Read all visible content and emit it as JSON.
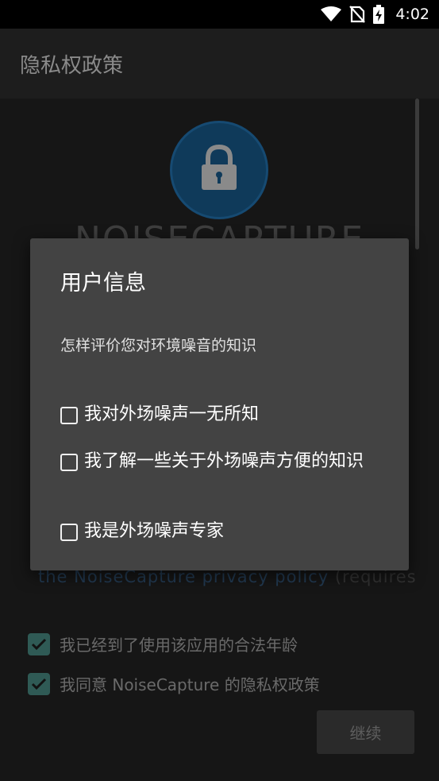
{
  "status_bar": {
    "time": "4:02",
    "icons": [
      "wifi-icon",
      "no-sim-icon",
      "battery-charging-icon"
    ]
  },
  "app_bar": {
    "title": "隐私权政策"
  },
  "background": {
    "logo_icon": "lock-icon",
    "logo_text": "NOISECAPTURE",
    "policy_link": "the NoiseCapture privacy policy",
    "policy_rest": " (requires",
    "agree_age_label": "我已经到了使用该应用的合法年龄",
    "agree_policy_label": "我同意 NoiseCapture 的隐私权政策",
    "continue_label": "继续"
  },
  "dialog": {
    "title": "用户信息",
    "question": "怎样评价您对环境噪音的知识",
    "options": [
      {
        "label": "我对外场噪声一无所知"
      },
      {
        "label": "我了解一些关于外场噪声方便的知识"
      },
      {
        "label": "我是外场噪声专家"
      }
    ]
  },
  "colors": {
    "accent": "#2f5a55",
    "dialog_bg": "#434343",
    "link": "#223a52"
  }
}
